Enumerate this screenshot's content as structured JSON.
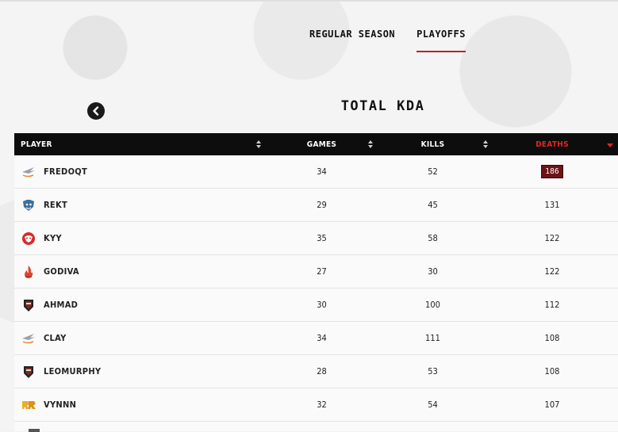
{
  "tabs": [
    {
      "label": "Regular Season",
      "active": false
    },
    {
      "label": "Playoffs",
      "active": true
    }
  ],
  "title": "Total KDA",
  "table": {
    "headers": {
      "player": "Player",
      "games": "Games",
      "kills": "Kills",
      "deaths": "Deaths"
    },
    "sorted_column": "deaths",
    "sort_direction": "desc",
    "rows": [
      {
        "player": "FREDOQT",
        "games": "34",
        "kills": "52",
        "deaths": "186",
        "logo": "wing-logo-icon",
        "highlight": true
      },
      {
        "player": "REKT",
        "games": "29",
        "kills": "45",
        "deaths": "131",
        "logo": "tiger-logo-icon"
      },
      {
        "player": "KYY",
        "games": "35",
        "kills": "58",
        "deaths": "122",
        "logo": "red-mask-logo-icon"
      },
      {
        "player": "GODIVA",
        "games": "27",
        "kills": "30",
        "deaths": "122",
        "logo": "flame-logo-icon"
      },
      {
        "player": "AHMAD",
        "games": "30",
        "kills": "100",
        "deaths": "112",
        "logo": "shield-logo-icon"
      },
      {
        "player": "CLAY",
        "games": "34",
        "kills": "111",
        "deaths": "108",
        "logo": "wing-logo-icon"
      },
      {
        "player": "LEOMURPHY",
        "games": "28",
        "kills": "53",
        "deaths": "108",
        "logo": "shield-logo-icon"
      },
      {
        "player": "VYNNN",
        "games": "32",
        "kills": "54",
        "deaths": "107",
        "logo": "rrq-logo-icon"
      }
    ]
  },
  "colors": {
    "accent": "#b3262b",
    "header_bg": "#0d0d0d",
    "sorted_header": "#e02525",
    "highlight_cell": "#6b1416"
  }
}
